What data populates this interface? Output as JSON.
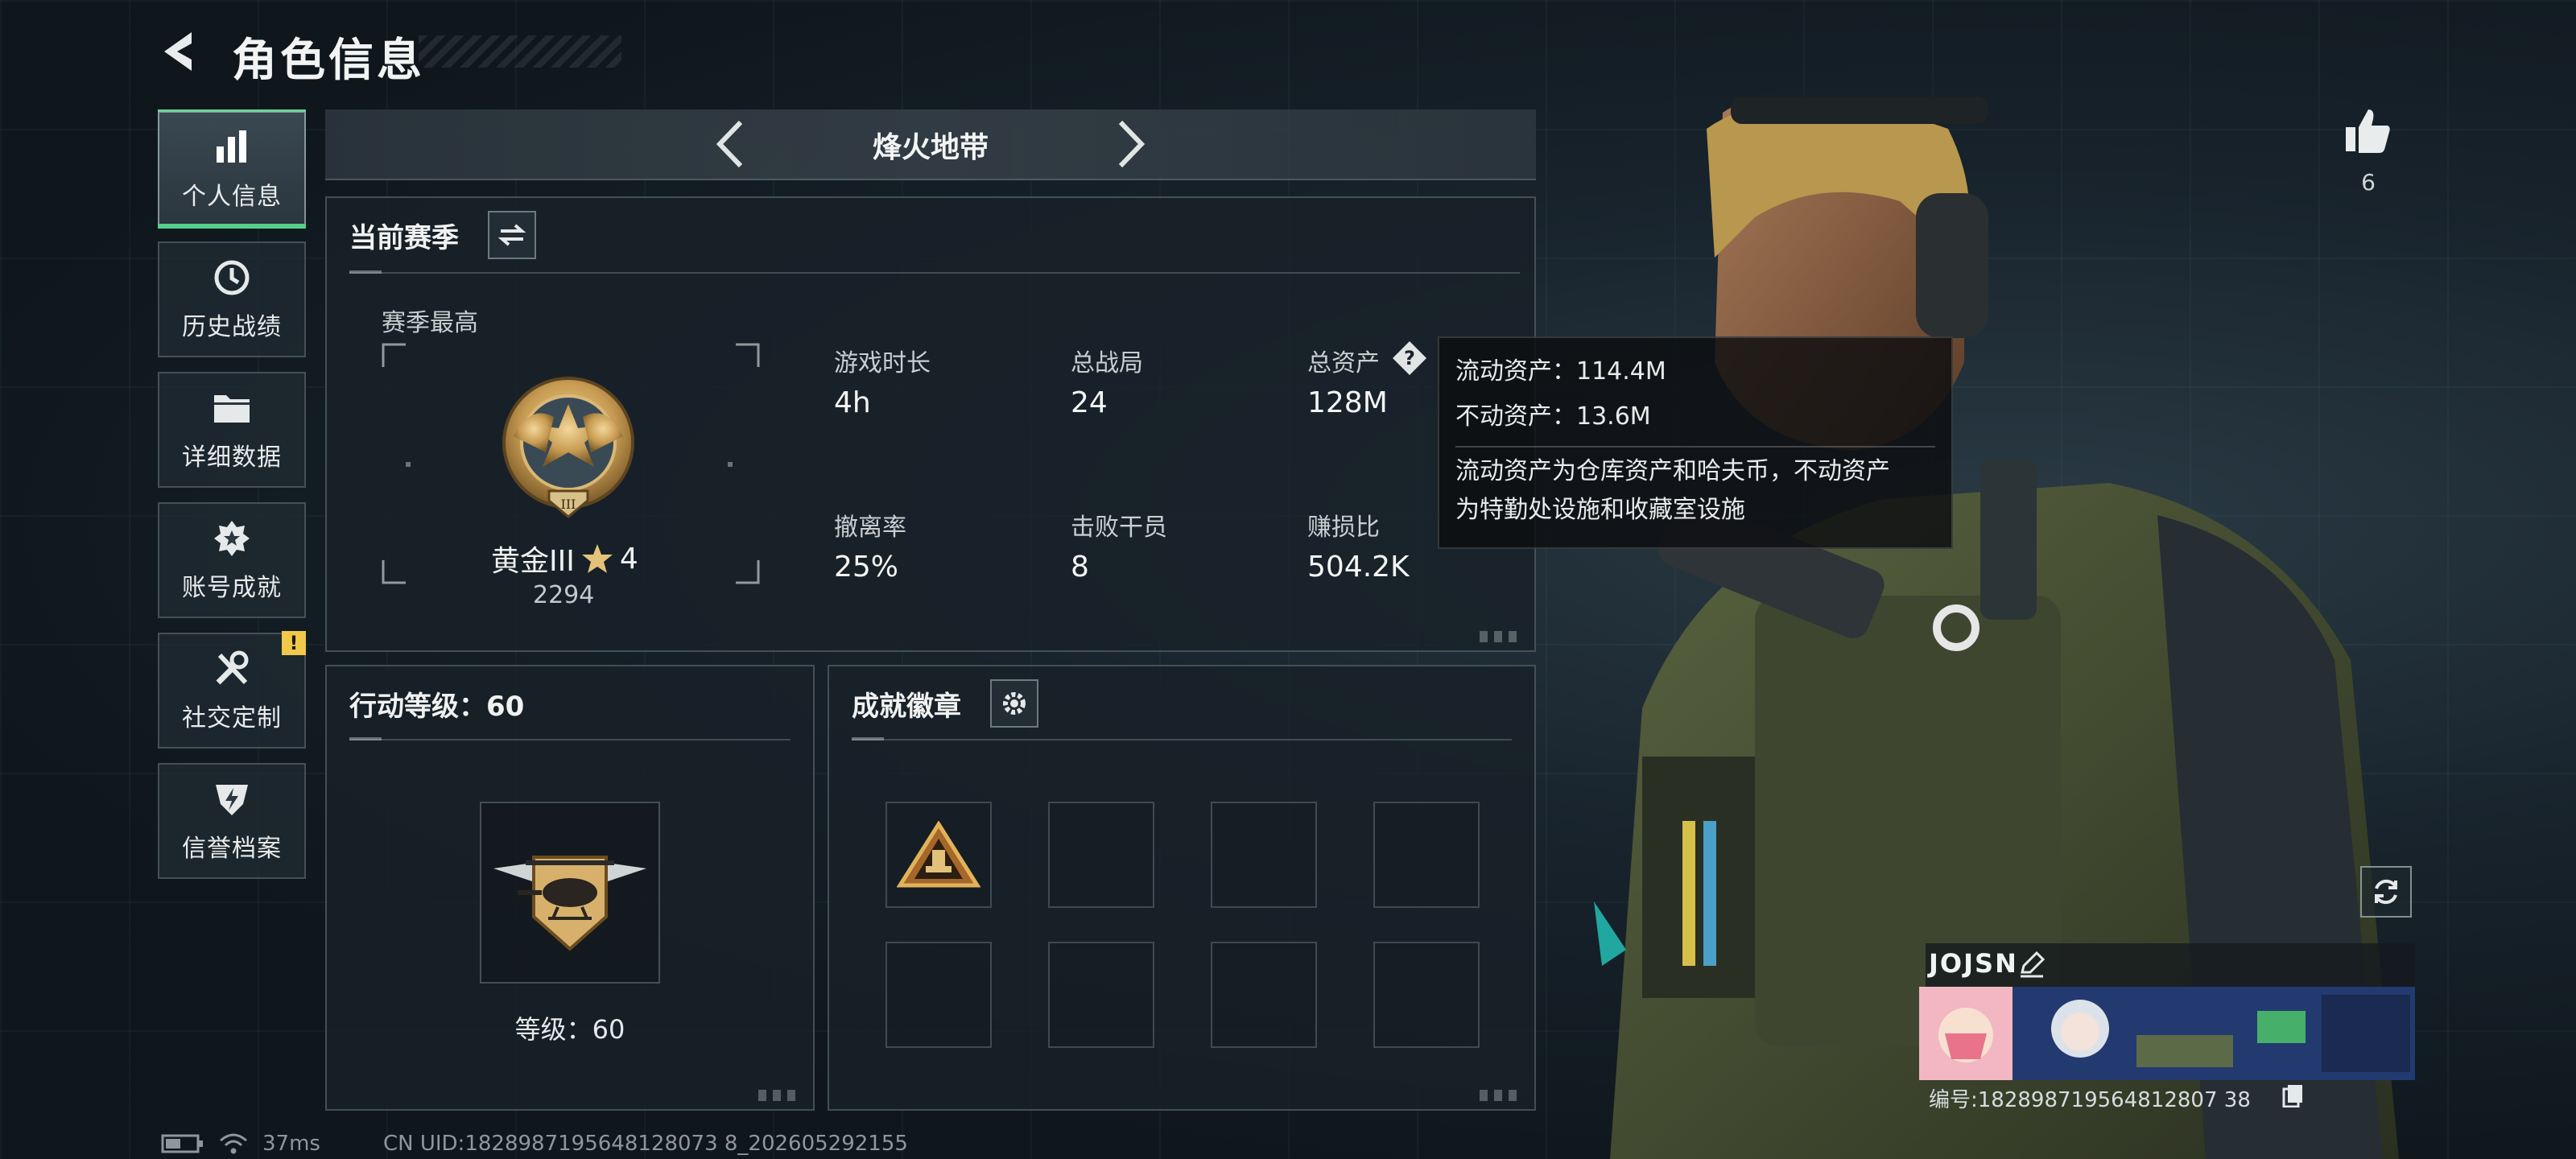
{
  "header": {
    "title": "角色信息"
  },
  "sidebar": {
    "items": [
      {
        "label": "个人信息",
        "icon": "bar-chart-icon",
        "active": true
      },
      {
        "label": "历史战绩",
        "icon": "history-clock-icon"
      },
      {
        "label": "详细数据",
        "icon": "folder-icon"
      },
      {
        "label": "账号成就",
        "icon": "achievement-star-icon"
      },
      {
        "label": "社交定制",
        "icon": "tools-icon",
        "badge": "!"
      },
      {
        "label": "信誉档案",
        "icon": "reputation-shield-icon"
      }
    ]
  },
  "mode": {
    "title": "烽火地带"
  },
  "season": {
    "title": "当前赛季",
    "best_label": "赛季最高",
    "rank_name": "黄金III",
    "rank_stars": "4",
    "rank_score": "2294",
    "stats": [
      {
        "label": "游戏时长",
        "value": "4h"
      },
      {
        "label": "总战局",
        "value": "24"
      },
      {
        "label": "总资产",
        "value": "128M"
      },
      {
        "label": "撤离率",
        "value": "25%"
      },
      {
        "label": "击败干员",
        "value": "8"
      },
      {
        "label": "赚损比",
        "value": "504.2K"
      }
    ]
  },
  "tooltip": {
    "liquid": "流动资产：114.4M",
    "fixed": "不动资产：13.6M",
    "desc_line1": "流动资产为仓库资产和哈夫币，不动资产",
    "desc_line2": "为特勤处设施和收藏室设施"
  },
  "level": {
    "title": "行动等级：60",
    "label": "等级：60"
  },
  "badges": {
    "title": "成就徽章",
    "filled": 1,
    "total": 8
  },
  "profile": {
    "likes": "6",
    "name": "JOJSN",
    "id": "编号:182898719564812807 38"
  },
  "footer": {
    "ping": "37ms",
    "uid": "CN UID:1828987195648128073 8_202605292155"
  },
  "colors": {
    "accent_green": "#52d08a",
    "warning_yellow": "#f0c94a",
    "gold": "#c79b52"
  }
}
